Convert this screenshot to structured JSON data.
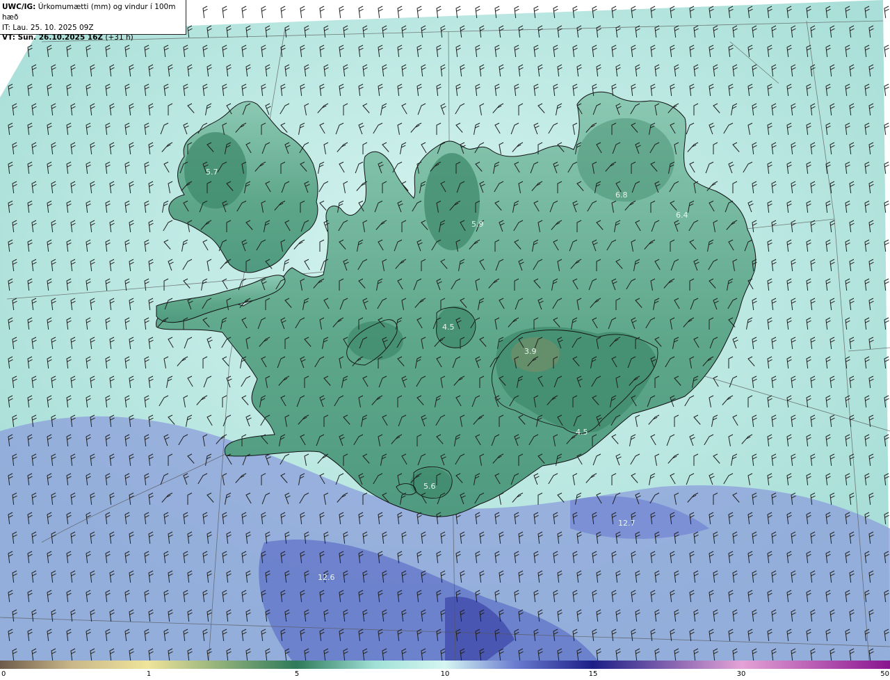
{
  "header": {
    "title_prefix": "UWC/IG:",
    "title_text": "Úrkomumætti (mm) og vindur í 100m hæð",
    "init_time": "IT: Lau. 25. 10. 2025 09Z",
    "valid_prefix": "VT: Sun. 26.10.2025 16Z",
    "valid_suffix": "(+31 h)"
  },
  "map_labels": [
    {
      "text": "5.7"
    },
    {
      "text": "5.9"
    },
    {
      "text": "6.8"
    },
    {
      "text": "6.4"
    },
    {
      "text": "4.5"
    },
    {
      "text": "3.9"
    },
    {
      "text": "4.5"
    },
    {
      "text": "5.6"
    },
    {
      "text": "12.7"
    },
    {
      "text": "12.6"
    }
  ],
  "colorbar": {
    "ticks": [
      "0",
      "1",
      "5",
      "10",
      "15",
      "30",
      "50"
    ],
    "colors": {
      "low": "#6e5a4a",
      "tan": "#c9b789",
      "yellow": "#efe49a",
      "green": "#2e7a5a",
      "teal": "#9fe0d6",
      "cyan": "#d6f6f2",
      "blue": "#6a7bd0",
      "navy": "#1c1f86",
      "pink": "#e4a3d6",
      "magenta": "#8a148f"
    }
  },
  "palette": {
    "sea": "#a9dfd8",
    "land": "#6fb39c",
    "land_dark": "#3e8a6c",
    "precip_blue": "#7f8fd6",
    "coast": "#1a1a1a"
  }
}
